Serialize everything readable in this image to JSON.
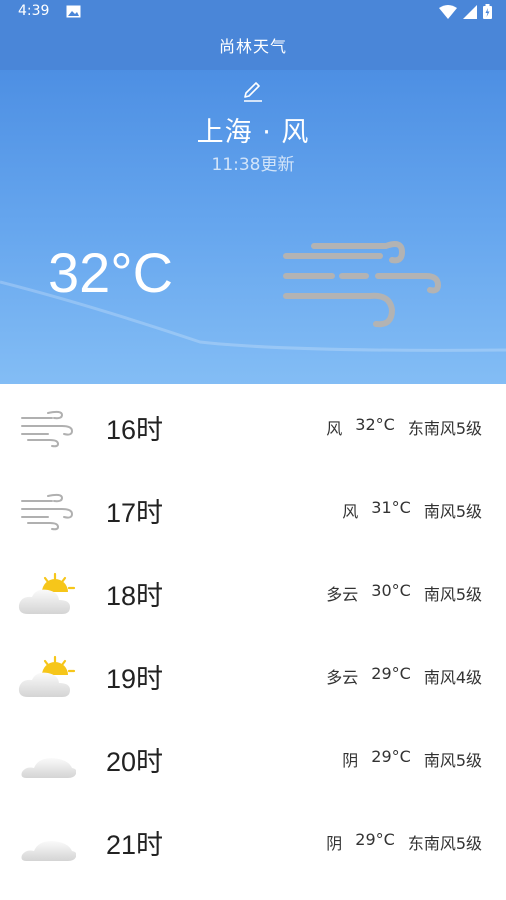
{
  "status_bar": {
    "time": "4:39"
  },
  "app_bar": {
    "title": "尚林天气"
  },
  "current": {
    "city": "上海 · 风",
    "update_time": "11:38更新",
    "temperature": "32°C",
    "icon": "wind-icon"
  },
  "forecast": [
    {
      "hour": "16时",
      "condition": "风",
      "temp": "32°C",
      "wind": "东南风5级",
      "icon": "wind-icon"
    },
    {
      "hour": "17时",
      "condition": "风",
      "temp": "31°C",
      "wind": "南风5级",
      "icon": "wind-icon"
    },
    {
      "hour": "18时",
      "condition": "多云",
      "temp": "30°C",
      "wind": "南风5级",
      "icon": "partly-cloudy-icon"
    },
    {
      "hour": "19时",
      "condition": "多云",
      "temp": "29°C",
      "wind": "南风4级",
      "icon": "partly-cloudy-icon"
    },
    {
      "hour": "20时",
      "condition": "阴",
      "temp": "29°C",
      "wind": "南风5级",
      "icon": "overcast-icon"
    },
    {
      "hour": "21时",
      "condition": "阴",
      "temp": "29°C",
      "wind": "东南风5级",
      "icon": "overcast-icon"
    }
  ],
  "colors": {
    "primary": "#4a86d8",
    "sky_top": "#4d8fe3",
    "sky_bottom": "#83bdf5",
    "sun": "#f6c61a",
    "wind_grey": "#b8b8b8"
  }
}
